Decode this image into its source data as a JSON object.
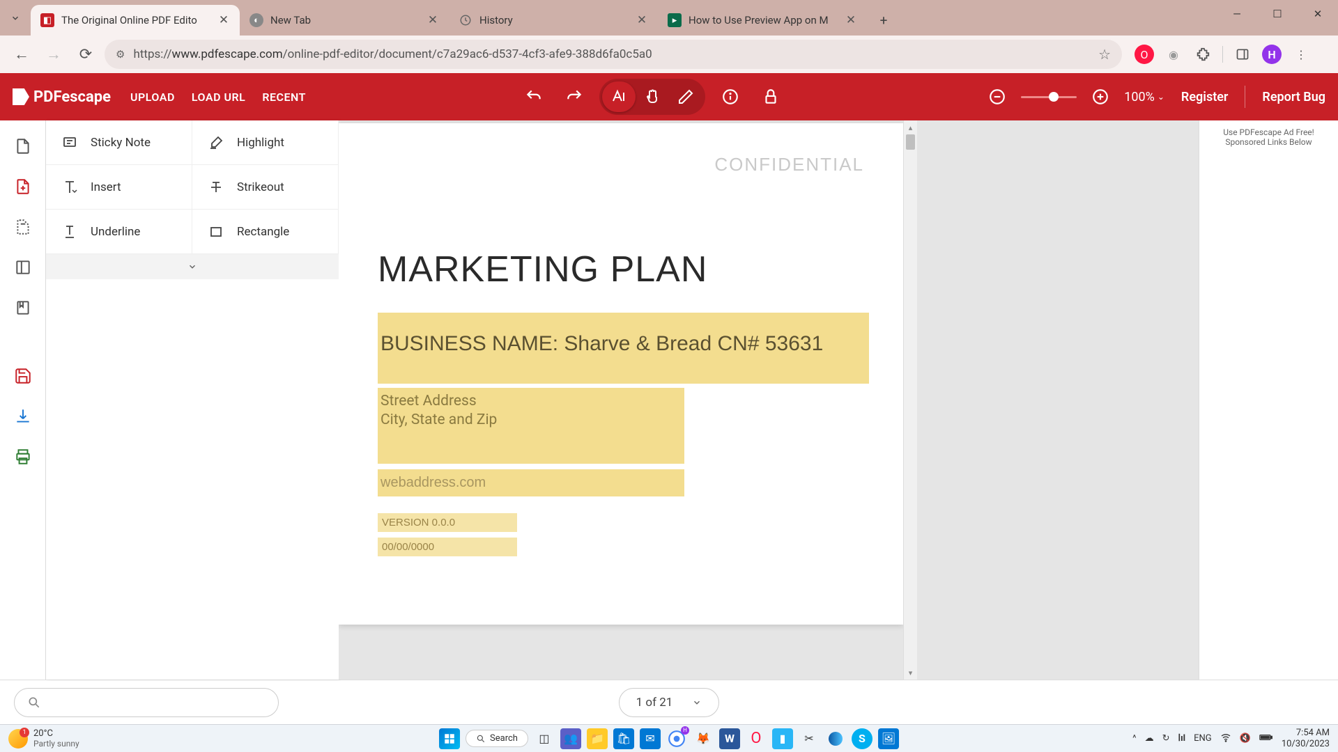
{
  "browser": {
    "tabs": [
      {
        "title": "The Original Online PDF Edito",
        "active": true
      },
      {
        "title": "New Tab",
        "active": false
      },
      {
        "title": "History",
        "active": false
      },
      {
        "title": "How to Use Preview App on M",
        "active": false
      }
    ],
    "url_prefix": "https://",
    "url_domain": "www.pdfescape.com",
    "url_path": "/online-pdf-editor/document/c7a29ac6-d537-4cf3-afe9-388d6fa0c5a0"
  },
  "app": {
    "logo_text": "PDFescape",
    "links": {
      "upload": "UPLOAD",
      "load_url": "LOAD URL",
      "recent": "RECENT"
    },
    "zoom": "100%",
    "register": "Register",
    "report_bug": "Report Bug"
  },
  "tools": {
    "sticky_note": "Sticky Note",
    "highlight": "Highlight",
    "insert": "Insert",
    "strikeout": "Strikeout",
    "underline": "Underline",
    "rectangle": "Rectangle"
  },
  "document": {
    "watermark": "CONFIDENTIAL",
    "title": "MARKETING PLAN",
    "business_name": "BUSINESS NAME: Sharve & Bread CN# 53631",
    "street": "Street Address",
    "city": "City, State and Zip",
    "web": "webaddress.com",
    "version": "VERSION 0.0.0",
    "date": "00/00/0000"
  },
  "ad": {
    "line1": "Use PDFescape Ad Free!",
    "line2": "Sponsored Links Below"
  },
  "footer": {
    "page_indicator": "1 of 21"
  },
  "taskbar": {
    "temp": "20°C",
    "weather": "Partly sunny",
    "search": "Search",
    "lang": "ENG",
    "time": "7:54 AM",
    "date": "10/30/2023",
    "notif": "1"
  }
}
